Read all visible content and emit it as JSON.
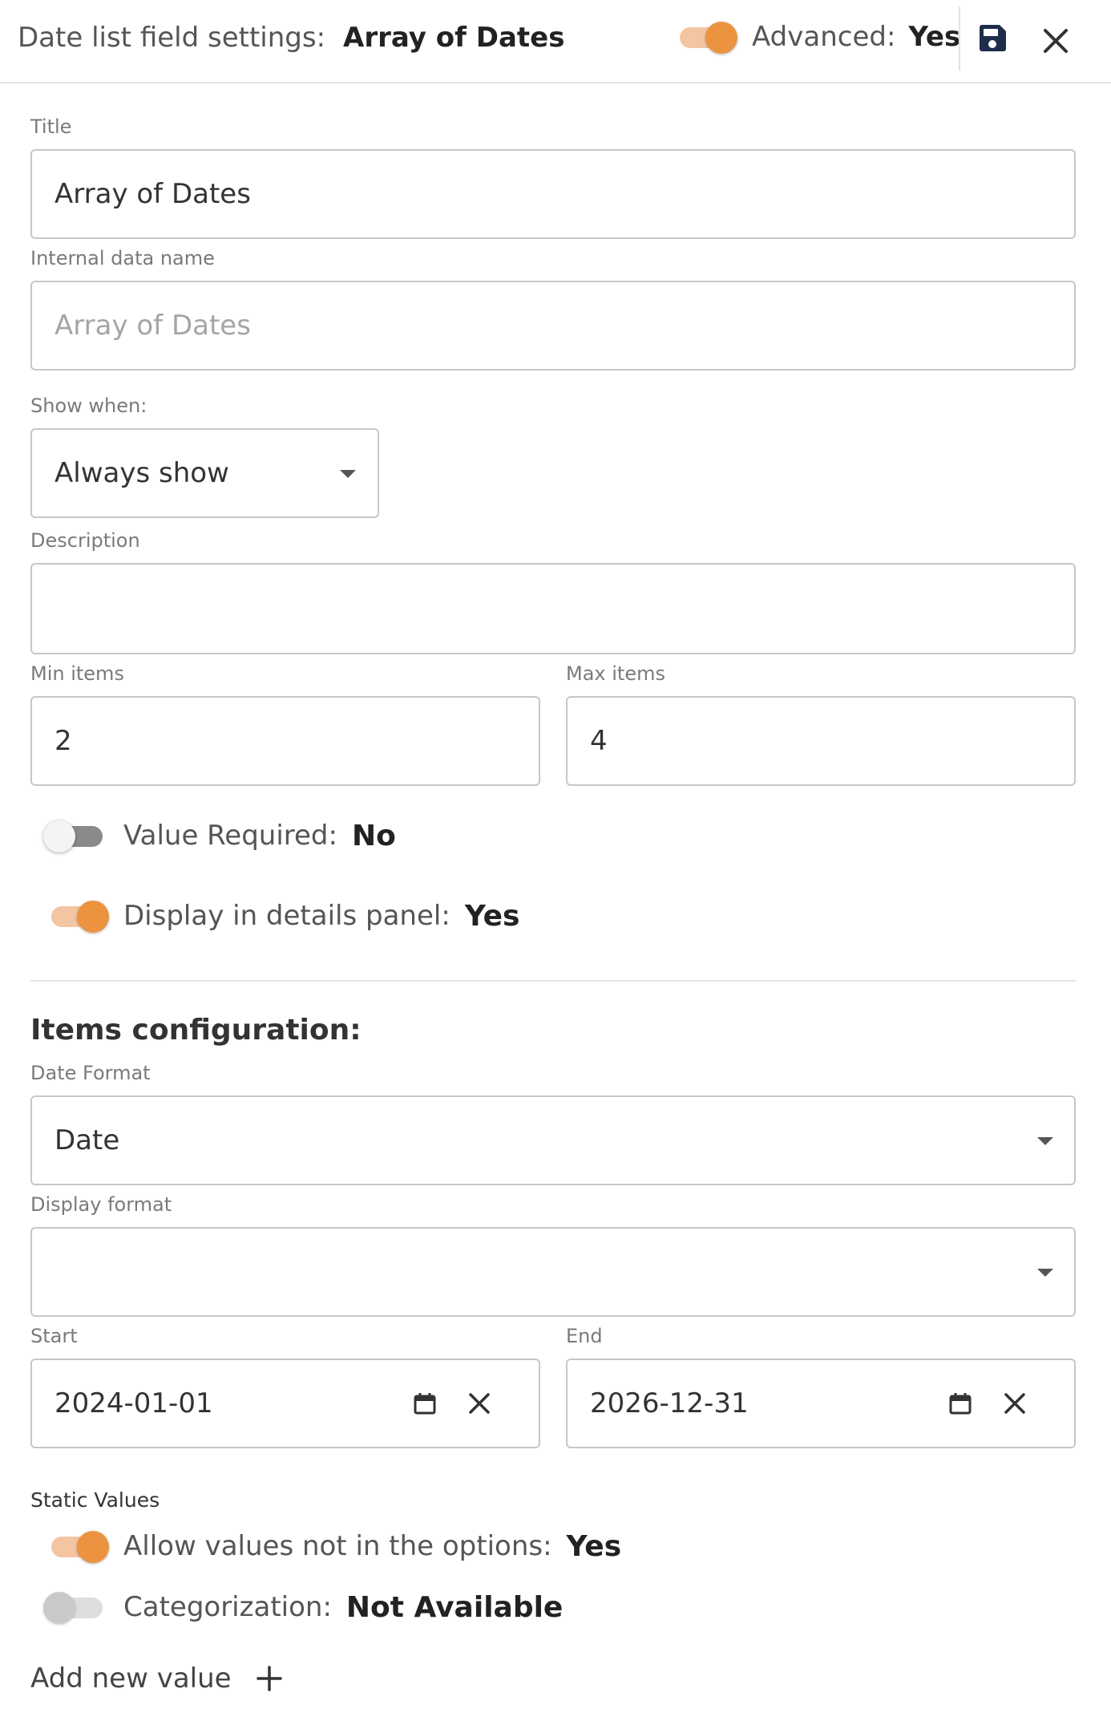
{
  "header": {
    "prefix": "Date list field settings:",
    "field_name": "Array of Dates",
    "advanced_label": "Advanced:",
    "advanced_value": "Yes",
    "save_icon": "save-icon",
    "close_icon": "close-icon"
  },
  "form": {
    "title": {
      "label": "Title",
      "value": "Array of Dates"
    },
    "internal_name": {
      "label": "Internal data name",
      "placeholder": "Array of Dates"
    },
    "show_when": {
      "label": "Show when:",
      "value": "Always show"
    },
    "description": {
      "label": "Description",
      "value": ""
    },
    "min_items": {
      "label": "Min items",
      "value": "2"
    },
    "max_items": {
      "label": "Max items",
      "value": "4"
    },
    "value_required": {
      "label": "Value Required:",
      "value": "No"
    },
    "display_in_details": {
      "label": "Display in details panel:",
      "value": "Yes"
    }
  },
  "items_config": {
    "title": "Items configuration:",
    "date_format": {
      "label": "Date Format",
      "value": "Date"
    },
    "display_format": {
      "label": "Display format",
      "value": ""
    },
    "start": {
      "label": "Start",
      "value": "2024-01-01"
    },
    "end": {
      "label": "End",
      "value": "2026-12-31"
    }
  },
  "static_values": {
    "title": "Static Values",
    "allow_values": {
      "label": "Allow values not in the options:",
      "value": "Yes"
    },
    "categorization": {
      "label": "Categorization:",
      "value": "Not Available"
    },
    "add_new_value": "Add new value"
  },
  "colors": {
    "accent": "#ec9340",
    "accent_track": "#f4c5a3",
    "save_icon": "#1f2d4d",
    "border": "#c7c7c7"
  }
}
